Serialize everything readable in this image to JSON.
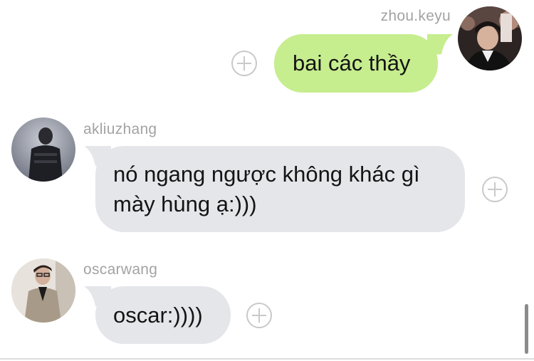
{
  "messages": [
    {
      "sender": "zhou.keyu",
      "direction": "outgoing",
      "text": "bai các thầy",
      "avatar_icon": "profile-photo-zhou-keyu",
      "bubble_color": "#c6ed8e"
    },
    {
      "sender": "akliuzhang",
      "direction": "incoming",
      "text_lines": [
        "nó ngang ngược không khác gì",
        "mày hùng ạ:)))"
      ],
      "avatar_icon": "profile-photo-akliuzhang",
      "bubble_color": "#e5e6ea"
    },
    {
      "sender": "oscarwang",
      "direction": "incoming",
      "text": "oscar:))))",
      "avatar_icon": "profile-photo-oscarwang",
      "bubble_color": "#e5e6ea"
    }
  ],
  "icons": {
    "add_reaction": "plus-circle-icon"
  },
  "colors": {
    "sender_name": "#a3a3a3",
    "outgoing_bubble": "#c6ed8e",
    "incoming_bubble": "#e5e6ea",
    "text": "#141414",
    "add_button": "#c9c9c9"
  }
}
